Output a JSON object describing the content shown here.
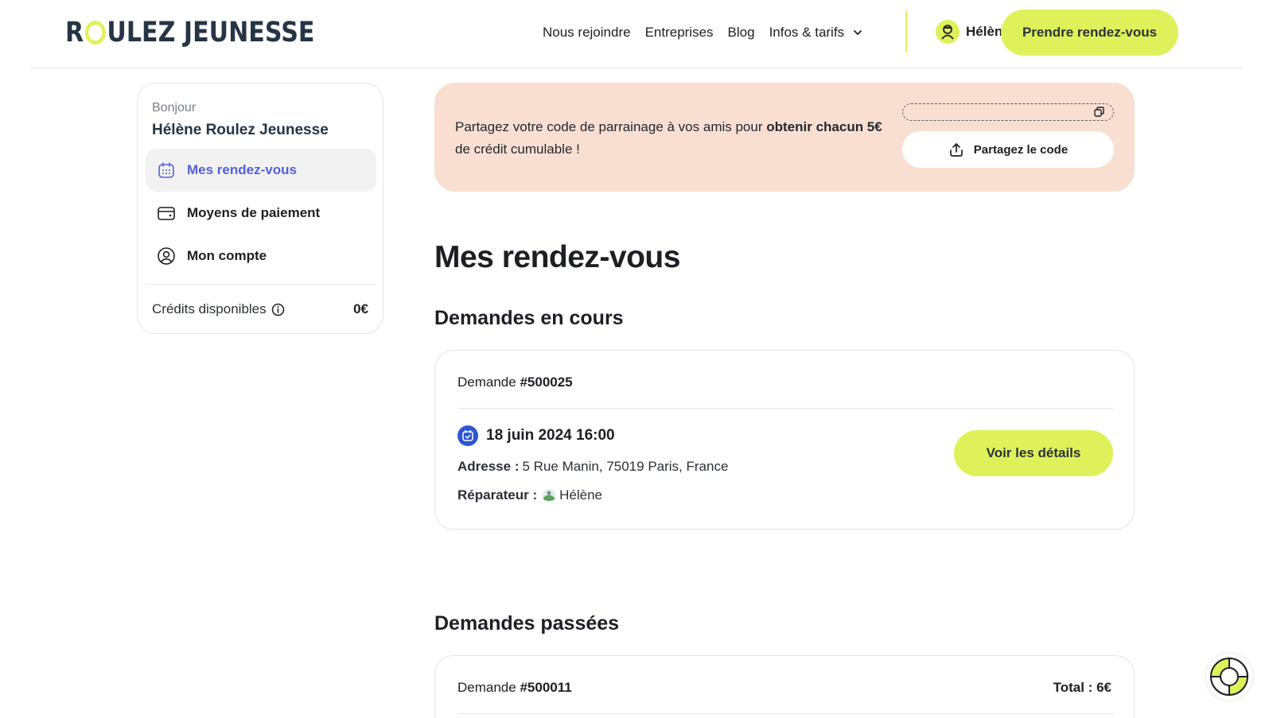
{
  "header": {
    "logo": {
      "left": "R",
      "right": "ULEZ JEUNESSE"
    },
    "nav": [
      "Nous rejoindre",
      "Entreprises",
      "Blog"
    ],
    "nav_dropdown": "Infos & tarifs",
    "user_name": "Hélène",
    "cta_label": "Prendre rendez-vous"
  },
  "sidebar": {
    "greeting": "Bonjour",
    "full_name": "Hélène Roulez Jeunesse",
    "items": [
      {
        "label": "Mes rendez-vous",
        "icon": "calendar-icon",
        "active": true
      },
      {
        "label": "Moyens de paiement",
        "icon": "wallet-icon",
        "active": false
      },
      {
        "label": "Mon compte",
        "icon": "user-circle-icon",
        "active": false
      }
    ],
    "credits_label": "Crédits disponibles",
    "credits_value": "0€"
  },
  "referral": {
    "text_before": "Partagez votre code de parrainage à vos amis pour ",
    "text_bold": "obtenir chacun 5€",
    "text_after": " de crédit cumulable !",
    "share_label": "Partagez le code"
  },
  "main": {
    "title": "Mes rendez-vous",
    "ongoing_title": "Demandes en cours",
    "past_title": "Demandes passées"
  },
  "ongoing": {
    "label": "Demande",
    "number": "#500025",
    "date": "18 juin 2024 16:00",
    "address_label": "Adresse :",
    "address": "5 Rue Manin, 75019 Paris, France",
    "repairer_label": "Réparateur :",
    "repairer": "Hélène",
    "details_label": "Voir les détails"
  },
  "past": {
    "label": "Demande",
    "number": "#500011",
    "total": "Total : 6€"
  },
  "colors": {
    "accent": "#dff15a",
    "brand_dark": "#263546",
    "active_link": "#5360d8",
    "banner": "#f9dfd2",
    "date_icon": "#2d56d0"
  }
}
